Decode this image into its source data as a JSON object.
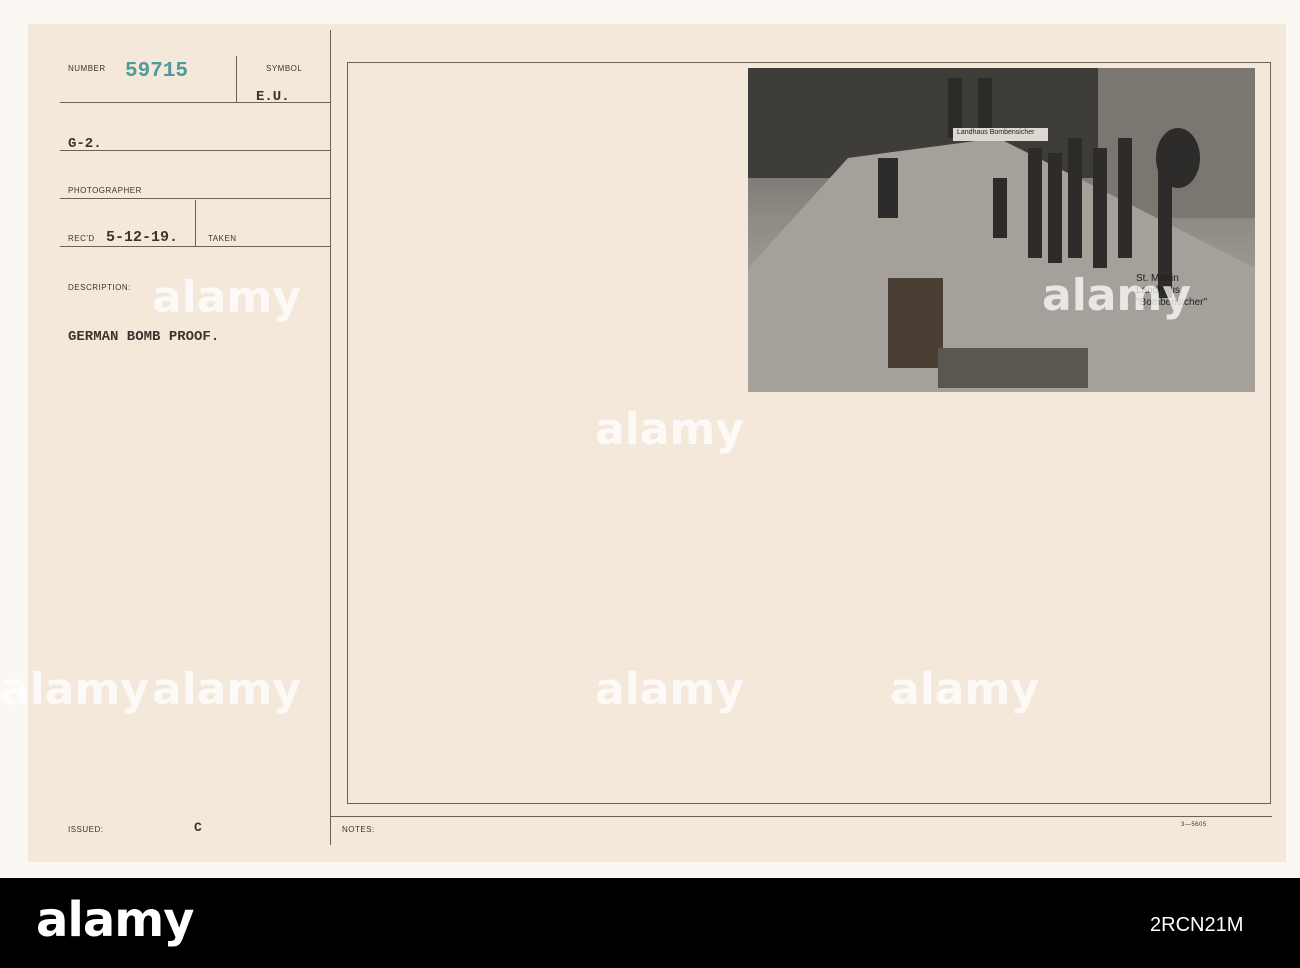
{
  "card": {
    "number_label": "NUMBER",
    "number": "59715",
    "symbol_label": "SYMBOL",
    "symbol": "E.U.",
    "source": "G-2.",
    "photographer_label": "PHOTOGRAPHER",
    "recd_label": "REC'D",
    "recd_date": "5-12-19.",
    "taken_label": "TAKEN",
    "description_label": "DESCRIPTION:",
    "description": "GERMAN BOMB PROOF.",
    "issued_label": "ISSUED:",
    "issued_mark": "C",
    "notes_label": "NOTES:",
    "form_number": "3—5605"
  },
  "photo": {
    "sign": "Landhaus Bombensicher",
    "caption_line1": "St. Martin",
    "caption_line2": "Landhaus",
    "caption_line3": "\"Bombensicher\""
  },
  "watermark": "alamy",
  "footer": {
    "logo": "alamy",
    "image_id": "2RCN21M"
  },
  "colors": {
    "number_ink": "#4f9a9a",
    "card": "#f3e8da"
  }
}
